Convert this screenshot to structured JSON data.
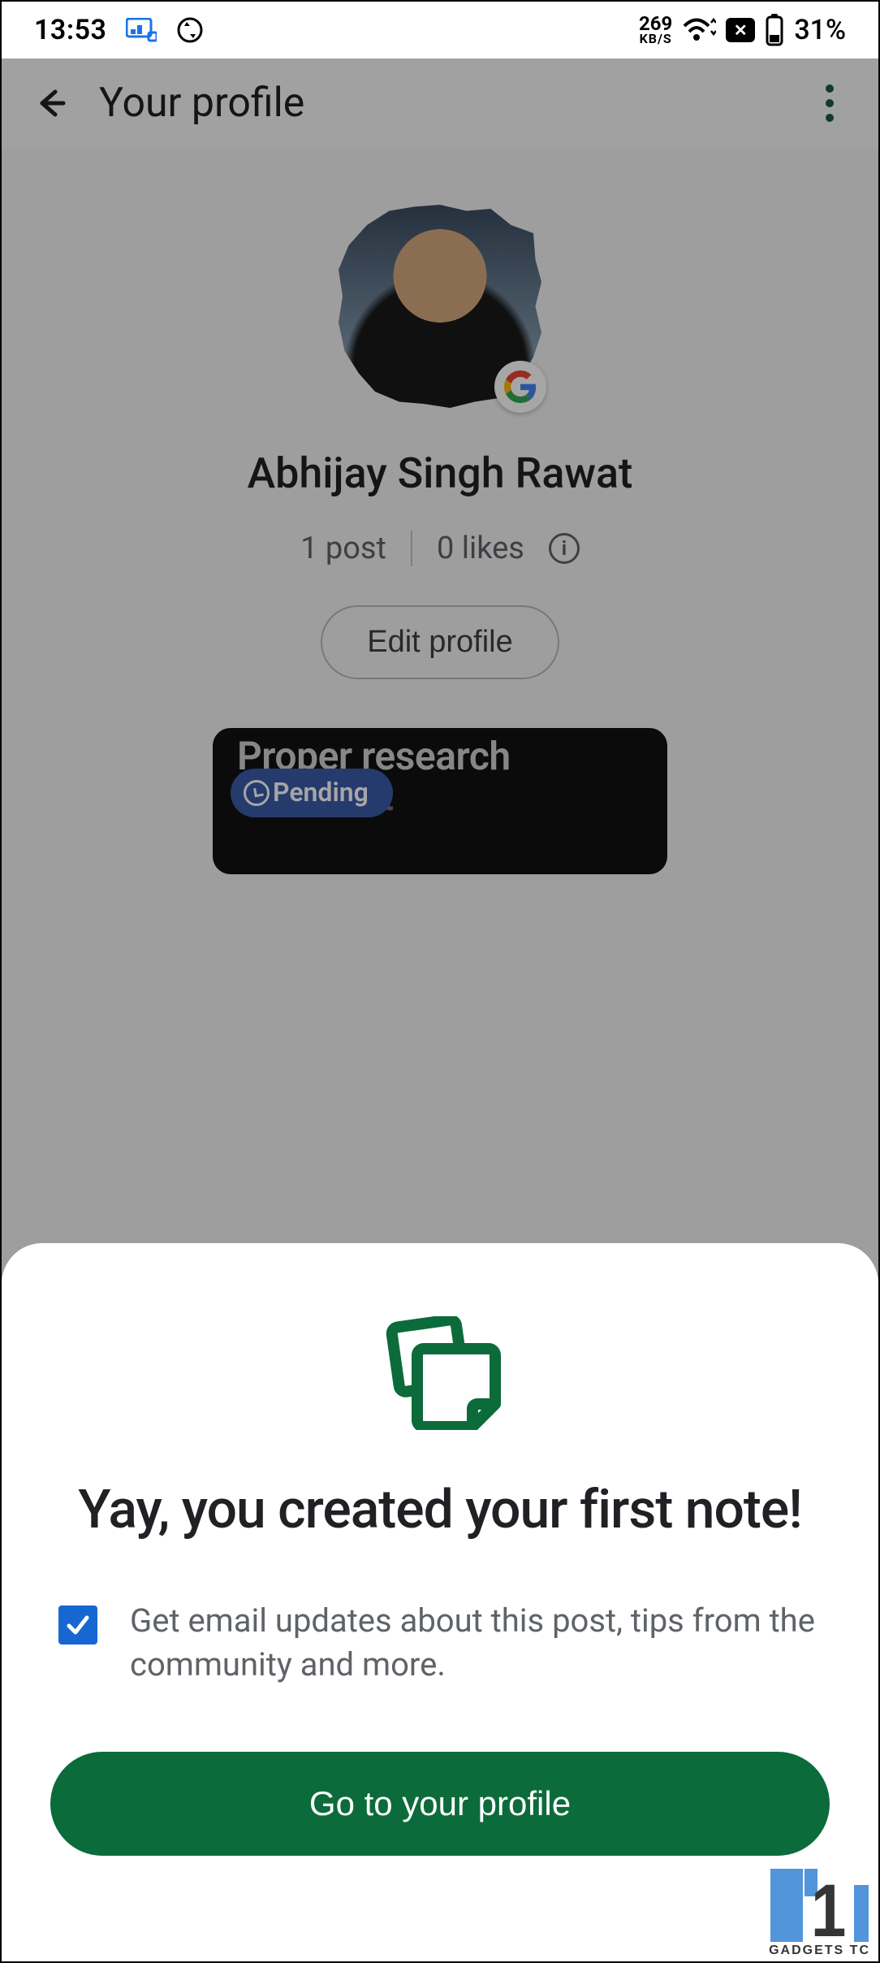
{
  "status": {
    "time": "13:53",
    "net_speed_value": "269",
    "net_speed_unit": "KB/S",
    "battery_pct": "31%"
  },
  "header": {
    "title": "Your profile"
  },
  "profile": {
    "name": "Abhijay Singh Rawat",
    "posts_label": "1 post",
    "likes_label": "0 likes",
    "edit_label": "Edit profile"
  },
  "card": {
    "title_line1": "Proper research",
    "title_line2": "assistant",
    "pending_label": "Pending"
  },
  "sheet": {
    "title": "Yay, you created your first note!",
    "checkbox_checked": true,
    "checkbox_label": "Get email updates about this post, tips from the community and more.",
    "cta_label": "Go to your profile"
  },
  "watermark": {
    "text": "GADGETS TC"
  }
}
